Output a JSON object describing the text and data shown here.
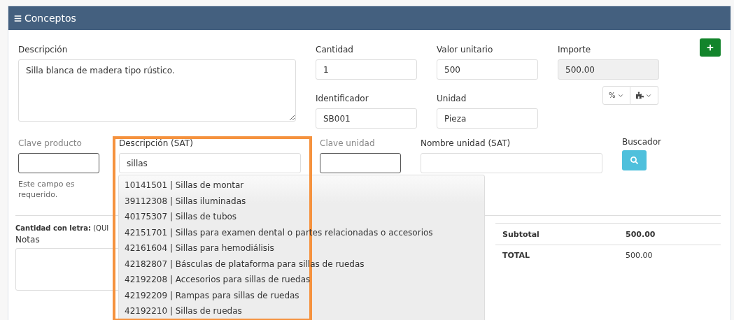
{
  "panel": {
    "title": "Conceptos"
  },
  "row1": {
    "description": {
      "label": "Descripción",
      "value": "Silla blanca de madera tipo rústico."
    },
    "fields": [
      {
        "label": "Cantidad",
        "value": "1",
        "readonly": false
      },
      {
        "label": "Valor unitario",
        "value": "500",
        "readonly": false
      },
      {
        "label": "Importe",
        "value": "500.00",
        "readonly": true
      }
    ]
  },
  "row2": {
    "fields": [
      {
        "label": "Identificador",
        "value": "SB001"
      },
      {
        "label": "Unidad",
        "value": "Pieza"
      }
    ],
    "percent_button": "%"
  },
  "row3": {
    "clave_producto": {
      "label": "Clave producto",
      "help": "Este campo es requerido."
    },
    "descripcion_sat": {
      "label": "Descripción (SAT)",
      "value": "sillas"
    },
    "clave_unidad": {
      "label": "Clave unidad"
    },
    "nombre_unidad": {
      "label": "Nombre unidad (SAT)"
    },
    "buscador": {
      "label": "Buscador"
    }
  },
  "suggestions": [
    "10141501 | Sillas de montar",
    "39112308 | Sillas iluminadas",
    "40175307 | Sillas de tubos",
    "42151701 | Sillas para examen dental o partes relacionadas o accesorios",
    "42161604 | Sillas para hemodiálisis",
    "42182807 | Básculas de plataforma para sillas de ruedas",
    "42192208 | Accesorios para sillas de ruedas",
    "42192209 | Rampas para sillas de ruedas",
    "42192210 | Sillas de ruedas"
  ],
  "amount_in_words": {
    "label": "Cantidad con letra:",
    "value": "(QUI"
  },
  "notes": {
    "label": "Notas"
  },
  "totals": [
    {
      "label": "Subtotal",
      "value": "500.00",
      "bold": true
    },
    {
      "label": "TOTAL",
      "value": "500.00",
      "bold": false
    }
  ]
}
